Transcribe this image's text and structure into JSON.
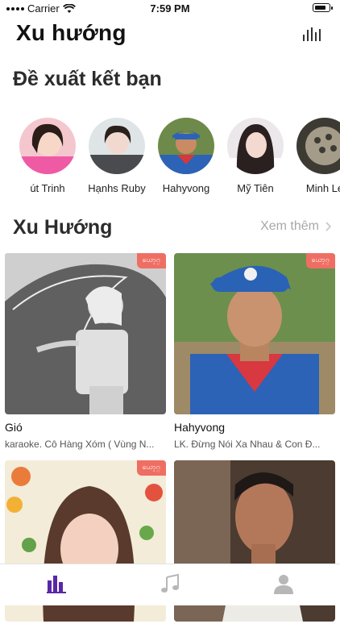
{
  "status_bar": {
    "carrier": "Carrier",
    "time": "7:59 PM"
  },
  "header": {
    "title": "Xu hướng"
  },
  "friend_suggestions": {
    "title": "Đề xuất kết bạn",
    "items": [
      {
        "name": "út Trinh"
      },
      {
        "name": "Hạnhs Ruby"
      },
      {
        "name": "Hahyvong"
      },
      {
        "name": "Mỹ Tiên"
      },
      {
        "name": "Minh Le"
      }
    ]
  },
  "trending": {
    "title": "Xu Hướng",
    "see_more": "Xem thêm",
    "badge": "ယော့ဂ္",
    "cards": [
      {
        "title": "Gió",
        "subtitle": "karaoke. Cô Hàng Xóm ( Vùng N..."
      },
      {
        "title": "Hahyvong",
        "subtitle": "LK. Đừng Nói Xa Nhau & Con Đ..."
      },
      {
        "title": "",
        "subtitle": ""
      },
      {
        "title": "",
        "subtitle": ""
      }
    ]
  },
  "tab_bar": {
    "items": [
      {
        "icon": "chart-icon",
        "active": true
      },
      {
        "icon": "music-note-icon",
        "active": false
      },
      {
        "icon": "user-icon",
        "active": false
      }
    ]
  },
  "colors": {
    "accent": "#5a28a6",
    "badge": "#ef6e63",
    "inactive_icon": "#b7b7b7"
  }
}
